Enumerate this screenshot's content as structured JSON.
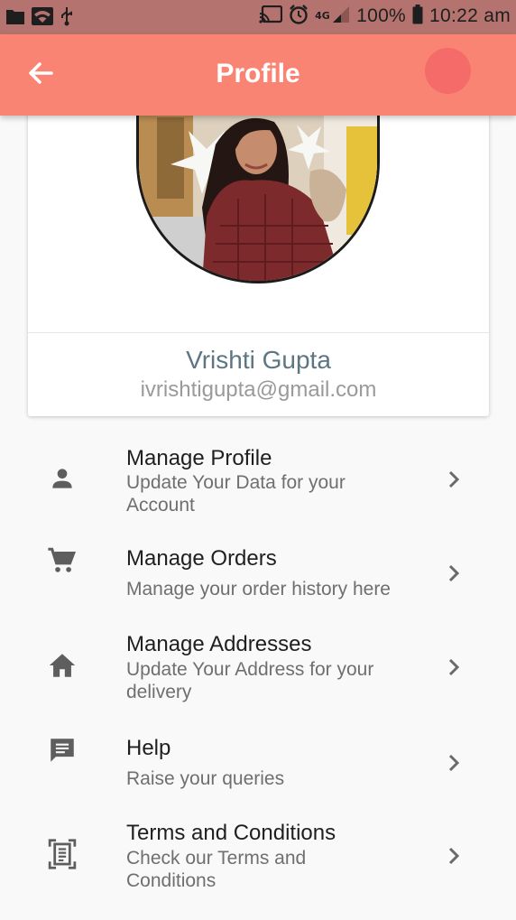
{
  "status_bar": {
    "battery": "100%",
    "time": "10:22 am",
    "network": "4G",
    "icons": [
      "folder-icon",
      "wifi-icon",
      "usb-icon",
      "cast-icon",
      "alarm-icon",
      "signal-icon",
      "battery-icon"
    ]
  },
  "app_bar": {
    "title": "Profile",
    "back_icon": "arrow-back-icon",
    "color": "#fa8474"
  },
  "profile": {
    "name": "Vrishti Gupta",
    "email": "ivrishtigupta@gmail.com",
    "avatar": "profile-photo"
  },
  "menu": [
    {
      "icon": "person-icon",
      "title": "Manage Profile",
      "subtitle_lines": [
        "Update Your Data for your",
        "Account"
      ]
    },
    {
      "icon": "cart-icon",
      "title": "Manage Orders",
      "subtitle_lines": [
        "Manage your order history here"
      ]
    },
    {
      "icon": "home-icon",
      "title": "Manage Addresses",
      "subtitle_lines": [
        "Update Your Address for your",
        "delivery"
      ]
    },
    {
      "icon": "message-icon",
      "title": "Help",
      "subtitle_lines": [
        "Raise your queries"
      ]
    },
    {
      "icon": "document-scan-icon",
      "title": "Terms and Conditions",
      "subtitle_lines": [
        "Check our Terms and",
        "Conditions"
      ]
    }
  ],
  "colors": {
    "status_bar": "#b5736f",
    "accent": "#fa8474",
    "name_text": "#5d7683"
  }
}
